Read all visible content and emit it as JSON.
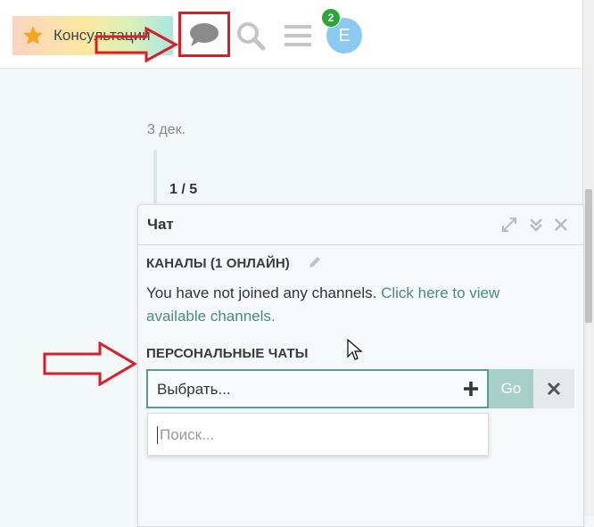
{
  "header": {
    "consult_label": "Консультации",
    "notification_count": "2",
    "avatar_letter": "E"
  },
  "feed": {
    "date": "3 дек.",
    "pager": "1 / 5"
  },
  "chat": {
    "title": "Чат",
    "channels_heading": "КАНАЛЫ (1 ОНЛАЙН)",
    "channels_text": "You have not joined any channels. ",
    "channels_link": "Click here to view available channels.",
    "personal_heading": "ПЕРСОНАЛЬНЫЕ ЧАТЫ",
    "select_value": "Выбрать...",
    "go_label": "Go",
    "search_placeholder": "Поиск..."
  },
  "colors": {
    "accent": "#4a8a84",
    "annotation_red": "#d61f26",
    "badge_green": "#2da637",
    "avatar_blue": "#8cc9ee",
    "go_button": "#a9cfc9"
  },
  "icons": [
    "star-icon",
    "chat-bubble-icon",
    "search-icon",
    "hamburger-menu-icon",
    "expand-icon",
    "collapse-icon",
    "close-icon",
    "pencil-icon",
    "plus-icon",
    "clear-icon",
    "cursor-icon"
  ]
}
